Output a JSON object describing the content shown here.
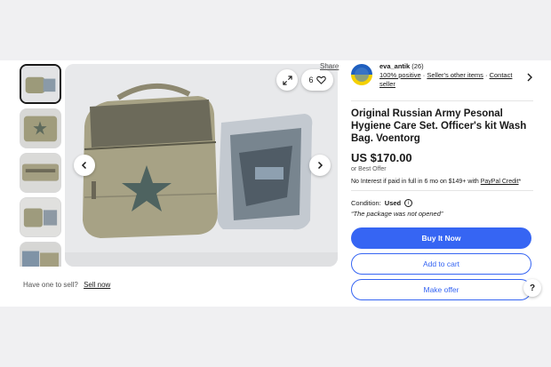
{
  "thumbnails": [
    {
      "alt": "thumb-1"
    },
    {
      "alt": "thumb-2"
    },
    {
      "alt": "thumb-3"
    },
    {
      "alt": "thumb-4"
    },
    {
      "alt": "thumb-5"
    }
  ],
  "gallery": {
    "favorite_count": "6"
  },
  "below_image": {
    "have_one": "Have one to sell?",
    "sell_now": "Sell now",
    "share": "Share"
  },
  "seller": {
    "name": "eva_antik",
    "count": "(26)",
    "positive": "100% positive",
    "sep1": " · ",
    "other_items": "Seller's other items",
    "sep2": " · ",
    "contact": "Contact seller"
  },
  "listing": {
    "title": "Original Russian Army Pesonal Hygiene Care Set. Officer's kit Wash Bag. Voentorg",
    "price": "US $170.00",
    "best_offer": "or Best Offer",
    "finance_text": "No Interest if paid in full in 6 mo on $149+ with ",
    "finance_link": "PayPal Credit",
    "finance_suffix": "*",
    "condition_label": "Condition:",
    "condition_value": "Used",
    "condition_note": "“The package was not opened”"
  },
  "buttons": {
    "buy": "Buy It Now",
    "cart": "Add to cart",
    "offer": "Make offer"
  },
  "help": "?",
  "colors": {
    "accent": "#3665f3",
    "text": "#191919"
  }
}
